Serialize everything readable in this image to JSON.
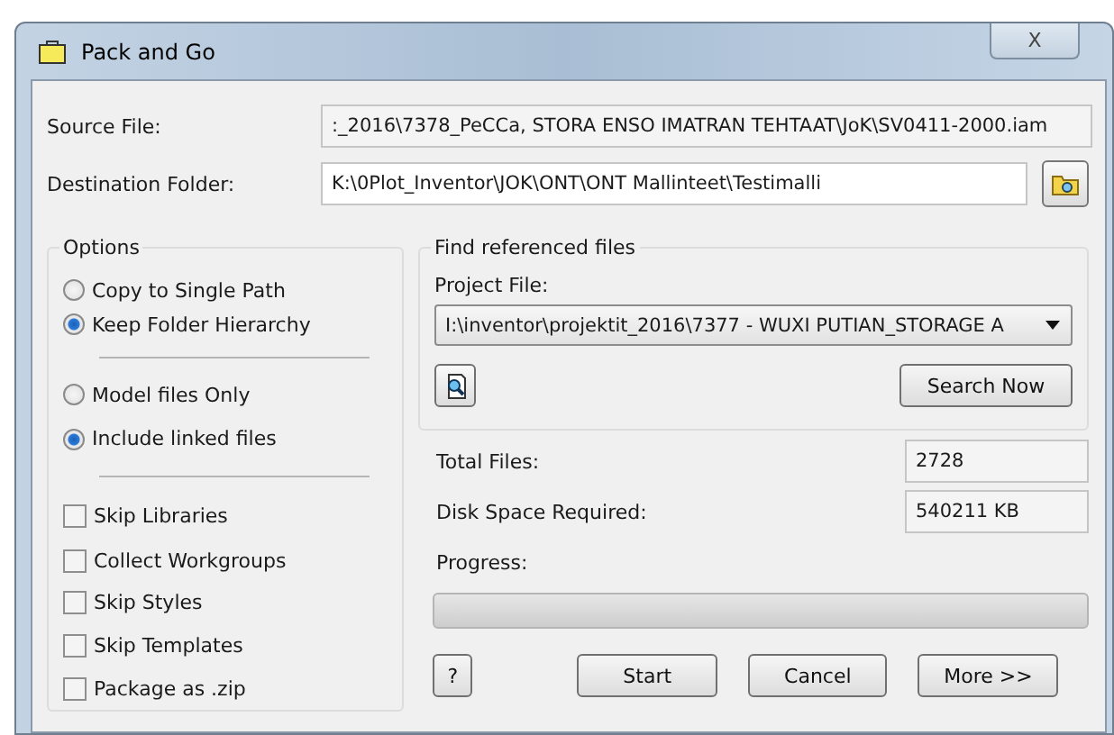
{
  "window": {
    "title": "Pack and Go",
    "close": "X"
  },
  "source_file": {
    "label": "Source File:",
    "value": ":_2016\\7378_PeCCa, STORA ENSO IMATRAN TEHTAAT\\JoK\\SV0411-2000.iam"
  },
  "destination_folder": {
    "label": "Destination Folder:",
    "value": "K:\\0Plot_Inventor\\JOK\\ONT\\ONT Mallinteet\\Testimalli"
  },
  "options": {
    "title": "Options",
    "path_mode": [
      {
        "label": "Copy to Single Path",
        "selected": false
      },
      {
        "label": "Keep Folder Hierarchy",
        "selected": true
      }
    ],
    "file_mode": [
      {
        "label": "Model files Only",
        "selected": false
      },
      {
        "label": "Include linked files",
        "selected": true
      }
    ],
    "checkboxes": [
      {
        "label": "Skip Libraries",
        "checked": false
      },
      {
        "label": "Collect Workgroups",
        "checked": false
      },
      {
        "label": "Skip Styles",
        "checked": false
      },
      {
        "label": "Skip Templates",
        "checked": false
      },
      {
        "label": "Package as .zip",
        "checked": false
      }
    ]
  },
  "find_referenced_files": {
    "title": "Find referenced files",
    "project_label": "Project File:",
    "project_value": "I:\\inventor\\projektit_2016\\7377 - WUXI PUTIAN_STORAGE A",
    "search_button": "Search Now"
  },
  "total_files": {
    "label": "Total Files:",
    "value": "2728"
  },
  "disk_space": {
    "label": "Disk Space Required:",
    "value": "540211 KB"
  },
  "progress": {
    "label": "Progress:",
    "level": 0
  },
  "help_button": "?",
  "buttons": [
    "Start",
    "Cancel",
    "More >>"
  ]
}
